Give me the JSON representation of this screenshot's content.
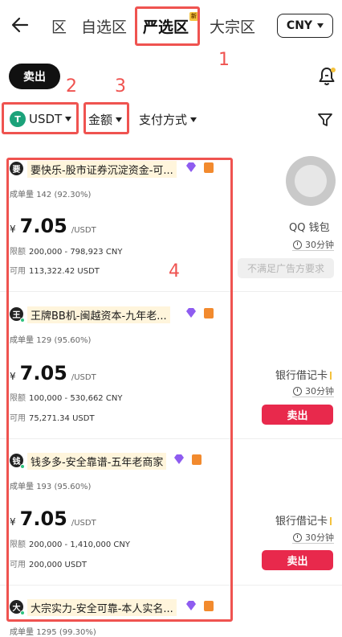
{
  "header": {
    "back_label": "←",
    "tabs": [
      {
        "label": "区"
      },
      {
        "label": "自选区"
      },
      {
        "label": "严选区",
        "badge": "新"
      },
      {
        "label": "大宗区"
      }
    ],
    "currency": "CNY"
  },
  "toolbar": {
    "sell_label": "卖出"
  },
  "filters": {
    "coin": "USDT",
    "coin_logo": "T",
    "amount": "金额",
    "payment": "支付方式"
  },
  "annotations": [
    "1",
    "2",
    "3",
    "4"
  ],
  "listings": [
    {
      "avatar": "要",
      "merchant": "要快乐-股市证券沉淀资金-可...",
      "stats_label": "成单量",
      "stats_value": "142 (92.30%)",
      "currency_symbol": "¥",
      "price": "7.05",
      "price_unit": "/USDT",
      "limit_label": "限额",
      "limit_value": "200,000 - 798,923 CNY",
      "available_label": "可用",
      "available_value": "113,322.42 USDT",
      "payment": "QQ 钱包",
      "time": "30分钟",
      "action": "不满足广告方要求"
    },
    {
      "avatar": "王",
      "merchant": "王牌BB机-闽越资本-九年老...",
      "stats_label": "成单量",
      "stats_value": "129 (95.60%)",
      "currency_symbol": "¥",
      "price": "7.05",
      "price_unit": "/USDT",
      "limit_label": "限额",
      "limit_value": "100,000 - 530,662 CNY",
      "available_label": "可用",
      "available_value": "75,271.34 USDT",
      "payment": "银行借记卡",
      "time": "30分钟",
      "action": "卖出"
    },
    {
      "avatar": "钱",
      "merchant": "钱多多-安全靠谱-五年老商家",
      "stats_label": "成单量",
      "stats_value": "193 (95.60%)",
      "currency_symbol": "¥",
      "price": "7.05",
      "price_unit": "/USDT",
      "limit_label": "限额",
      "limit_value": "200,000 - 1,410,000 CNY",
      "available_label": "可用",
      "available_value": "200,000 USDT",
      "payment": "银行借记卡",
      "time": "30分钟",
      "action": "卖出"
    },
    {
      "avatar": "大",
      "merchant": "大宗实力-安全可靠-本人实名...",
      "stats_label": "成单量",
      "stats_value": "1295 (99.30%)"
    }
  ],
  "colors": {
    "accent_red": "#e8294c",
    "annotation_red": "#ef5350",
    "usdt_green": "#1ba27a",
    "verify_purple": "#8e5cf0",
    "shield_orange": "#f28a2e"
  }
}
